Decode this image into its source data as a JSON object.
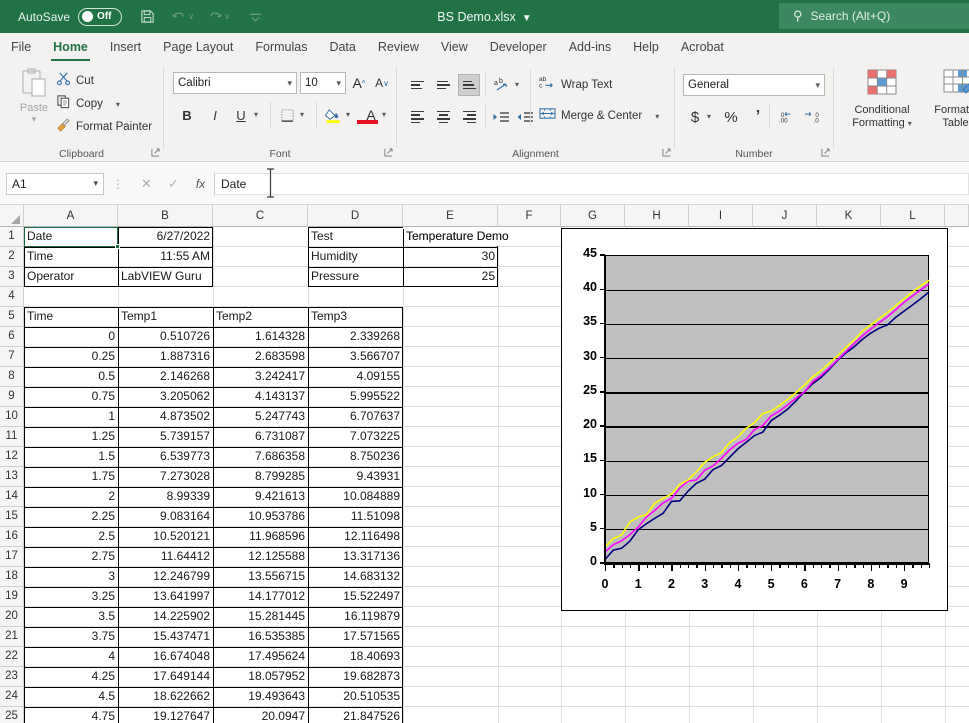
{
  "titlebar": {
    "autosave_label": "AutoSave",
    "autosave_state": "Off",
    "document_title": "BS Demo.xlsx",
    "title_chevron": "⌵",
    "save_icon": "💾",
    "undo_icon": "↶",
    "redo_icon": "↷",
    "customize_icon": "⌵",
    "chevron": "∨",
    "search_icon": "⌕",
    "search_placeholder": "Search (Alt+Q)"
  },
  "tabs": [
    {
      "label": "File",
      "active": false
    },
    {
      "label": "Home",
      "active": true
    },
    {
      "label": "Insert",
      "active": false
    },
    {
      "label": "Page Layout",
      "active": false
    },
    {
      "label": "Formulas",
      "active": false
    },
    {
      "label": "Data",
      "active": false
    },
    {
      "label": "Review",
      "active": false
    },
    {
      "label": "View",
      "active": false
    },
    {
      "label": "Developer",
      "active": false
    },
    {
      "label": "Add-ins",
      "active": false
    },
    {
      "label": "Help",
      "active": false
    },
    {
      "label": "Acrobat",
      "active": false
    }
  ],
  "ribbon": {
    "clipboard": {
      "group_label": "Clipboard",
      "paste_label": "Paste",
      "cut_label": "Cut",
      "copy_label": "Copy",
      "format_painter_label": "Format Painter",
      "cut_icon": "✂",
      "copy_icon": "❐",
      "format_painter_icon": "🖌",
      "dialog_launcher": "⤡"
    },
    "font": {
      "group_label": "Font",
      "font_name": "Calibri",
      "font_size": "10",
      "grow_font": "A",
      "shrink_font": "A",
      "bold": "B",
      "italic": "I",
      "underline": "U",
      "borders_icon": "⊞",
      "fill_color_icon": "◢",
      "font_color_icon": "A",
      "dialog_launcher": "⤡"
    },
    "alignment": {
      "group_label": "Alignment",
      "orientation_icon": "ab",
      "wrap_text_label": "Wrap Text",
      "merge_center_label": "Merge & Center",
      "decrease_indent": "←",
      "increase_indent": "→",
      "dialog_launcher": "⤡"
    },
    "number": {
      "group_label": "Number",
      "format": "General",
      "currency_icon": "$",
      "percent_icon": "%",
      "comma_icon": "’",
      "decrease_decimal": ".00",
      "increase_decimal": ".0",
      "dialog_launcher": "⤡"
    },
    "styles": {
      "conditional_formatting_label": "Conditional\nFormatting",
      "conditional_formatting_l1": "Conditional",
      "conditional_formatting_l2": "Formatting",
      "format_as_table_l1": "Format as",
      "format_as_table_l2": "Table"
    }
  },
  "formula_bar": {
    "name_box": "A1",
    "cancel_icon": "✕",
    "enter_icon": "✓",
    "function_icon": "fx",
    "formula_value": "Date"
  },
  "grid": {
    "columns": [
      "A",
      "B",
      "C",
      "D",
      "E",
      "F",
      "G",
      "H",
      "I",
      "J",
      "K",
      "L"
    ],
    "rows": [
      1,
      2,
      3,
      4,
      5,
      6,
      7,
      8,
      9,
      10,
      11,
      12,
      13,
      14,
      15,
      16,
      17,
      18,
      19,
      20,
      21,
      22,
      23,
      24,
      25
    ],
    "selected_cell": "A1",
    "header_cells": [
      {
        "ref": "A1",
        "col": 0,
        "row": 1,
        "value": "Date",
        "align": "left"
      },
      {
        "ref": "B1",
        "col": 1,
        "row": 1,
        "value": "6/27/2022",
        "align": "right"
      },
      {
        "ref": "D1",
        "col": 3,
        "row": 1,
        "value": "Test",
        "align": "left"
      },
      {
        "ref": "E1",
        "col": 4,
        "row": 1,
        "value": "Temperature Demo",
        "align": "left"
      },
      {
        "ref": "A2",
        "col": 0,
        "row": 2,
        "value": "Time",
        "align": "left"
      },
      {
        "ref": "B2",
        "col": 1,
        "row": 2,
        "value": "11:55 AM",
        "align": "right"
      },
      {
        "ref": "D2",
        "col": 3,
        "row": 2,
        "value": "Humidity",
        "align": "left"
      },
      {
        "ref": "E2",
        "col": 4,
        "row": 2,
        "value": "30",
        "align": "right"
      },
      {
        "ref": "A3",
        "col": 0,
        "row": 3,
        "value": "Operator",
        "align": "left"
      },
      {
        "ref": "B3",
        "col": 1,
        "row": 3,
        "value": "LabVIEW Guru",
        "align": "left"
      },
      {
        "ref": "D3",
        "col": 3,
        "row": 3,
        "value": "Pressure",
        "align": "left"
      },
      {
        "ref": "E3",
        "col": 4,
        "row": 3,
        "value": "25",
        "align": "right"
      }
    ],
    "table_headers": [
      "Time",
      "Temp1",
      "Temp2",
      "Temp3"
    ],
    "table_header_row": 5,
    "table_rows": [
      {
        "row": 6,
        "Time": "0",
        "Temp1": "0.510726",
        "Temp2": "1.614328",
        "Temp3": "2.339268"
      },
      {
        "row": 7,
        "Time": "0.25",
        "Temp1": "1.887316",
        "Temp2": "2.683598",
        "Temp3": "3.566707"
      },
      {
        "row": 8,
        "Time": "0.5",
        "Temp1": "2.146268",
        "Temp2": "3.242417",
        "Temp3": "4.09155"
      },
      {
        "row": 9,
        "Time": "0.75",
        "Temp1": "3.205062",
        "Temp2": "4.143137",
        "Temp3": "5.995522"
      },
      {
        "row": 10,
        "Time": "1",
        "Temp1": "4.873502",
        "Temp2": "5.247743",
        "Temp3": "6.707637"
      },
      {
        "row": 11,
        "Time": "1.25",
        "Temp1": "5.739157",
        "Temp2": "6.731087",
        "Temp3": "7.073225"
      },
      {
        "row": 12,
        "Time": "1.5",
        "Temp1": "6.539773",
        "Temp2": "7.686358",
        "Temp3": "8.750236"
      },
      {
        "row": 13,
        "Time": "1.75",
        "Temp1": "7.273028",
        "Temp2": "8.799285",
        "Temp3": "9.43931"
      },
      {
        "row": 14,
        "Time": "2",
        "Temp1": "8.99339",
        "Temp2": "9.421613",
        "Temp3": "10.084889"
      },
      {
        "row": 15,
        "Time": "2.25",
        "Temp1": "9.083164",
        "Temp2": "10.953786",
        "Temp3": "11.51098"
      },
      {
        "row": 16,
        "Time": "2.5",
        "Temp1": "10.520121",
        "Temp2": "11.968596",
        "Temp3": "12.116498"
      },
      {
        "row": 17,
        "Time": "2.75",
        "Temp1": "11.64412",
        "Temp2": "12.125588",
        "Temp3": "13.317136"
      },
      {
        "row": 18,
        "Time": "3",
        "Temp1": "12.246799",
        "Temp2": "13.556715",
        "Temp3": "14.683132"
      },
      {
        "row": 19,
        "Time": "3.25",
        "Temp1": "13.641997",
        "Temp2": "14.177012",
        "Temp3": "15.522497"
      },
      {
        "row": 20,
        "Time": "3.5",
        "Temp1": "14.225902",
        "Temp2": "15.281445",
        "Temp3": "16.119879"
      },
      {
        "row": 21,
        "Time": "3.75",
        "Temp1": "15.437471",
        "Temp2": "16.535385",
        "Temp3": "17.571565"
      },
      {
        "row": 22,
        "Time": "4",
        "Temp1": "16.674048",
        "Temp2": "17.495624",
        "Temp3": "18.40693"
      },
      {
        "row": 23,
        "Time": "4.25",
        "Temp1": "17.649144",
        "Temp2": "18.057952",
        "Temp3": "19.682873"
      },
      {
        "row": 24,
        "Time": "4.5",
        "Temp1": "18.622662",
        "Temp2": "19.493643",
        "Temp3": "20.510535"
      },
      {
        "row": 25,
        "Time": "4.75",
        "Temp1": "19.127647",
        "Temp2": "20.0947",
        "Temp3": "21.847526"
      }
    ]
  },
  "chart_data": {
    "type": "line",
    "title": "",
    "xlabel": "",
    "ylabel": "",
    "xlim": [
      0,
      9.75
    ],
    "ylim": [
      0,
      45
    ],
    "yticks": [
      0,
      5,
      10,
      15,
      20,
      25,
      30,
      35,
      40,
      45
    ],
    "xticks": [
      0,
      1,
      2,
      3,
      4,
      5,
      6,
      7,
      8,
      9
    ],
    "grid": true,
    "legend": "none",
    "plot_background": "#bfbfbf",
    "x": [
      0,
      0.25,
      0.5,
      0.75,
      1,
      1.25,
      1.5,
      1.75,
      2,
      2.25,
      2.5,
      2.75,
      3,
      3.25,
      3.5,
      3.75,
      4,
      4.25,
      4.5,
      4.75,
      5,
      5.25,
      5.5,
      5.75,
      6,
      6.25,
      6.5,
      6.75,
      7,
      7.25,
      7.5,
      7.75,
      8,
      8.25,
      8.5,
      8.75,
      9,
      9.25,
      9.5,
      9.75
    ],
    "series": [
      {
        "name": "Temp1",
        "color": "#000080",
        "values": [
          0.510726,
          1.887316,
          2.146268,
          3.205062,
          4.873502,
          5.739157,
          6.539773,
          7.273028,
          8.99339,
          9.083164,
          10.520121,
          11.64412,
          12.246799,
          13.641997,
          14.225902,
          15.437471,
          16.674048,
          17.649144,
          18.622662,
          19.127647,
          20.8,
          21.6,
          22.5,
          23.7,
          25.0,
          26.2,
          27.1,
          28.3,
          29.6,
          30.7,
          31.6,
          32.7,
          33.6,
          34.3,
          34.8,
          35.9,
          36.8,
          37.7,
          38.6,
          39.6
        ]
      },
      {
        "name": "Temp2",
        "color": "#FF00FF",
        "values": [
          1.614328,
          2.683598,
          3.242417,
          4.143137,
          5.247743,
          6.731087,
          7.686358,
          8.799285,
          9.421613,
          10.953786,
          11.968596,
          12.125588,
          13.556715,
          14.177012,
          15.281445,
          16.535385,
          17.495624,
          18.057952,
          19.493643,
          20.0947,
          21.5,
          22.2,
          23.1,
          24.1,
          25.0,
          26.5,
          27.4,
          28.5,
          29.7,
          30.9,
          32.1,
          33.2,
          34.2,
          35.1,
          36.0,
          37.0,
          38.1,
          39.0,
          39.9,
          40.8
        ]
      },
      {
        "name": "Temp3",
        "color": "#FFFF00",
        "values": [
          2.339268,
          3.566707,
          4.09155,
          5.995522,
          6.707637,
          7.073225,
          8.750236,
          9.43931,
          10.084889,
          11.51098,
          12.116498,
          13.317136,
          14.683132,
          15.522497,
          16.119879,
          17.571565,
          18.40693,
          19.682873,
          20.510535,
          21.847526,
          22.2,
          23.0,
          23.9,
          24.9,
          26.0,
          27.2,
          28.1,
          29.2,
          30.3,
          31.5,
          32.6,
          33.9,
          34.8,
          35.7,
          36.6,
          37.6,
          38.6,
          39.6,
          40.5,
          41.3
        ]
      }
    ]
  }
}
